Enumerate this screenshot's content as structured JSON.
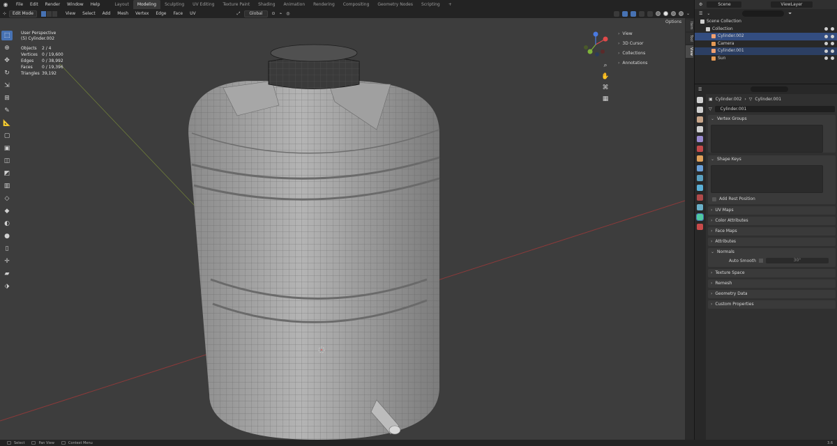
{
  "topbar": {
    "menu": [
      "File",
      "Edit",
      "Render",
      "Window",
      "Help"
    ],
    "workspaces": [
      "Layout",
      "Modeling",
      "Sculpting",
      "UV Editing",
      "Texture Paint",
      "Shading",
      "Animation",
      "Rendering",
      "Compositing",
      "Geometry Nodes",
      "Scripting",
      "+"
    ],
    "active_workspace": "Modeling"
  },
  "viewport_header": {
    "mode": "Edit Mode",
    "menus": [
      "View",
      "Select",
      "Add",
      "Mesh",
      "Vertex",
      "Edge",
      "Face",
      "UV"
    ],
    "orientation": "Global",
    "options": "Options"
  },
  "overlay": {
    "view_name": "User Perspective",
    "object_name": "(5) Cylinder.002",
    "stats": [
      {
        "label": "Objects",
        "value": "2 / 4"
      },
      {
        "label": "Vertices",
        "value": "0 / 19,600"
      },
      {
        "label": "Edges",
        "value": "0 / 38,992"
      },
      {
        "label": "Faces",
        "value": "0 / 19,396"
      },
      {
        "label": "Triangles",
        "value": "39,192"
      }
    ]
  },
  "npanel": {
    "items": [
      "View",
      "3D Cursor",
      "Collections",
      "Annotations"
    ],
    "tabs": [
      "Item",
      "Tool",
      "View"
    ]
  },
  "outliner": {
    "scene": "Scene",
    "view_layer": "ViewLayer",
    "rows": [
      {
        "name": "Scene Collection",
        "color": "#cfcfcf",
        "state": ""
      },
      {
        "name": "Collection",
        "color": "#cfcfcf",
        "state": ""
      },
      {
        "name": "Cylinder.002",
        "color": "#f0a070",
        "state": "sel"
      },
      {
        "name": "Camera",
        "color": "#e59a55",
        "state": ""
      },
      {
        "name": "Cylinder.001",
        "color": "#f0a070",
        "state": "sel2"
      },
      {
        "name": "Sun",
        "color": "#e59a55",
        "state": ""
      }
    ]
  },
  "properties": {
    "breadcrumb": [
      "Cylinder.002",
      "Cylinder.001"
    ],
    "datablock": "Cylinder.001",
    "panels": [
      {
        "title": "Vertex Groups",
        "open": true,
        "kind": "list"
      },
      {
        "title": "Shape Keys",
        "open": true,
        "kind": "list-check",
        "check_label": "Add Rest Position"
      },
      {
        "title": "UV Maps",
        "open": false
      },
      {
        "title": "Color Attributes",
        "open": false
      },
      {
        "title": "Face Maps",
        "open": false
      },
      {
        "title": "Attributes",
        "open": false
      },
      {
        "title": "Normals",
        "open": true,
        "kind": "smooth",
        "smooth_label": "Auto Smooth",
        "smooth_value": "30°"
      },
      {
        "title": "Texture Space",
        "open": false
      },
      {
        "title": "Remesh",
        "open": false
      },
      {
        "title": "Geometry Data",
        "open": false
      },
      {
        "title": "Custom Properties",
        "open": false
      }
    ],
    "tab_colors": [
      "#d0d0d0",
      "#d0d0d0",
      "#c9a68a",
      "#d0d0d0",
      "#9a8bd1",
      "#c44a4a",
      "#e0a15a",
      "#6aa0d8",
      "#5aa0c0",
      "#5ab0d6",
      "#b04a4a",
      "#6ab0c8",
      "#4fc9a0",
      "#c84a4a"
    ]
  },
  "statusbar": {
    "items": [
      "Select",
      "Pan View",
      "Context Menu"
    ],
    "version": "3.6"
  }
}
